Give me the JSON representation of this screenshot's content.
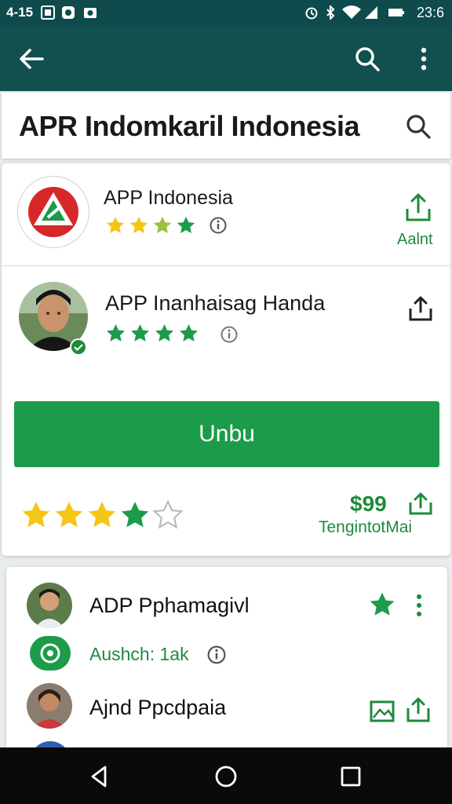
{
  "status": {
    "time_left": "4-15",
    "time_right": "23:6",
    "icons": [
      "image-icon",
      "record-icon",
      "camera-icon",
      "alarm-icon",
      "bluetooth-icon",
      "wifi-icon",
      "signal-icon",
      "battery-icon"
    ]
  },
  "appbar": {
    "icons": [
      "back-arrow-icon",
      "search-icon",
      "more-vert-icon"
    ]
  },
  "search": {
    "query": "APR Indomkaril Indonesia"
  },
  "results": [
    {
      "title": "APP Indonesia",
      "rating": 4,
      "action_label": "Aalnt"
    },
    {
      "title": "APP Inanhaisag Handa",
      "rating": 4,
      "action_label": ""
    }
  ],
  "install": {
    "button_label": "Unbu",
    "rating": 4,
    "price": "$99",
    "price_sub": "TengintotMai"
  },
  "list": [
    {
      "title": "ADP Pphamagivl"
    },
    {
      "meta": "Aushch: 1ak"
    },
    {
      "title": "Ajnd Ppcdpaia"
    }
  ],
  "colors": {
    "appbar": "#11504f",
    "accent_green": "#1c9b4a",
    "star_gold": "#f5c518",
    "star_green": "#1c9b4a"
  },
  "navbar": {
    "icons": [
      "back-triangle-icon",
      "home-circle-icon",
      "recents-square-icon"
    ]
  }
}
